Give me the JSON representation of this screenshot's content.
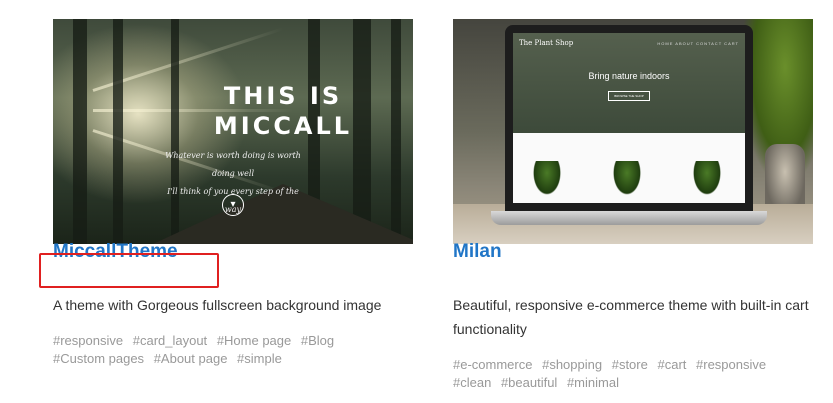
{
  "cards": [
    {
      "title": "MiccallTheme",
      "description": "A theme with Gorgeous fullscreen background image",
      "tags": [
        "#responsive",
        "#card_layout",
        "#Home page",
        "#Blog",
        "#Custom pages",
        "#About page",
        "#simple"
      ],
      "preview": {
        "title_line1": "THIS IS",
        "title_line2": "MICCALL",
        "sub_line1": "Whatever is worth doing is worth doing well",
        "sub_line2": "I'll think of you every step of the way",
        "icon": "arrow-down-circle-icon"
      }
    },
    {
      "title": "Milan",
      "description": "Beautiful, responsive e-commerce theme with built-in cart functionality",
      "tags": [
        "#e-commerce",
        "#shopping",
        "#store",
        "#cart",
        "#responsive",
        "#clean",
        "#beautiful",
        "#minimal"
      ],
      "preview": {
        "site_name": "The Plant Shop",
        "nav": "HOME  ABOUT  CONTACT  CART",
        "hero": "Bring nature indoors",
        "button": "BROWSE THE SHOP"
      }
    }
  ],
  "colors": {
    "link": "#2176c7",
    "highlight": "#e02020",
    "tag": "#999999",
    "text": "#333333"
  }
}
